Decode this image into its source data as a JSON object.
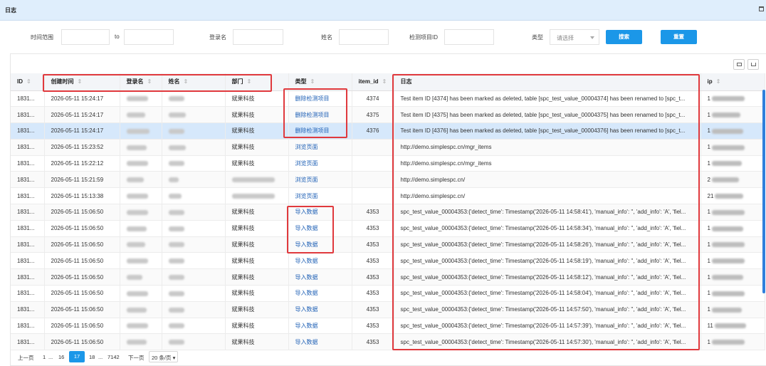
{
  "window": {
    "title": "日志"
  },
  "filters": {
    "time_range_label": "时间范围",
    "to_label": "to",
    "login_label": "登录名",
    "name_label": "姓名",
    "item_id_label": "检测项目ID",
    "type_label": "类型",
    "type_placeholder": "请选择",
    "search_button": "搜索",
    "reset_button": "重置"
  },
  "table": {
    "columns": [
      "ID",
      "创建时间",
      "登录名",
      "姓名",
      "部门",
      "类型",
      "item_id",
      "日志",
      "ip"
    ],
    "rows": [
      {
        "id": "1831...",
        "time": "2026-05-11 15:24:17",
        "dept": "斌果科技",
        "type": "删除检测项目",
        "item": "4374",
        "log": "Test item ID [4374] has been marked as deleted, table [spc_test_value_00004374] has been renamed to [spc_t...",
        "ip": "1"
      },
      {
        "id": "1831...",
        "time": "2026-05-11 15:24:17",
        "dept": "斌果科技",
        "type": "删除检测项目",
        "item": "4375",
        "log": "Test item ID [4375] has been marked as deleted, table [spc_test_value_00004375] has been renamed to [spc_t...",
        "ip": "1"
      },
      {
        "id": "1831...",
        "time": "2026-05-11 15:24:17",
        "dept": "斌果科技",
        "type": "删除检测项目",
        "item": "4376",
        "log": "Test item ID [4376] has been marked as deleted, table [spc_test_value_00004376] has been renamed to [spc_t...",
        "ip": "1"
      },
      {
        "id": "1831...",
        "time": "2026-05-11 15:23:52",
        "dept": "斌果科技",
        "type": "浏览页面",
        "item": "",
        "log": "http://demo.simplespc.cn/mgr_items",
        "ip": "1"
      },
      {
        "id": "1831...",
        "time": "2026-05-11 15:22:12",
        "dept": "斌果科技",
        "type": "浏览页面",
        "item": "",
        "log": "http://demo.simplespc.cn/mgr_items",
        "ip": "1"
      },
      {
        "id": "1831...",
        "time": "2026-05-11 15:21:59",
        "dept": "",
        "type": "浏览页面",
        "item": "",
        "log": "http://demo.simplespc.cn/",
        "ip": "2"
      },
      {
        "id": "1831...",
        "time": "2026-05-11 15:13:38",
        "dept": "",
        "type": "浏览页面",
        "item": "",
        "log": "http://demo.simplespc.cn/",
        "ip": "21"
      },
      {
        "id": "1831...",
        "time": "2026-05-11 15:06:50",
        "dept": "斌果科技",
        "type": "导入数据",
        "item": "4353",
        "log": "spc_test_value_00004353:{'detect_time': Timestamp('2026-05-11 14:58:41'), 'manual_info': '', 'add_info': 'A', 'fiel...",
        "ip": "1"
      },
      {
        "id": "1831...",
        "time": "2026-05-11 15:06:50",
        "dept": "斌果科技",
        "type": "导入数据",
        "item": "4353",
        "log": "spc_test_value_00004353:{'detect_time': Timestamp('2026-05-11 14:58:34'), 'manual_info': '', 'add_info': 'A', 'fiel...",
        "ip": "1"
      },
      {
        "id": "1831...",
        "time": "2026-05-11 15:06:50",
        "dept": "斌果科技",
        "type": "导入数据",
        "item": "4353",
        "log": "spc_test_value_00004353:{'detect_time': Timestamp('2026-05-11 14:58:26'), 'manual_info': '', 'add_info': 'A', 'fiel...",
        "ip": "1"
      },
      {
        "id": "1831...",
        "time": "2026-05-11 15:06:50",
        "dept": "斌果科技",
        "type": "导入数据",
        "item": "4353",
        "log": "spc_test_value_00004353:{'detect_time': Timestamp('2026-05-11 14:58:19'), 'manual_info': '', 'add_info': 'A', 'fiel...",
        "ip": "1"
      },
      {
        "id": "1831...",
        "time": "2026-05-11 15:06:50",
        "dept": "斌果科技",
        "type": "导入数据",
        "item": "4353",
        "log": "spc_test_value_00004353:{'detect_time': Timestamp('2026-05-11 14:58:12'), 'manual_info': '', 'add_info': 'A', 'fiel...",
        "ip": "1"
      },
      {
        "id": "1831...",
        "time": "2026-05-11 15:06:50",
        "dept": "斌果科技",
        "type": "导入数据",
        "item": "4353",
        "log": "spc_test_value_00004353:{'detect_time': Timestamp('2026-05-11 14:58:04'), 'manual_info': '', 'add_info': 'A', 'fiel...",
        "ip": "1"
      },
      {
        "id": "1831...",
        "time": "2026-05-11 15:06:50",
        "dept": "斌果科技",
        "type": "导入数据",
        "item": "4353",
        "log": "spc_test_value_00004353:{'detect_time': Timestamp('2026-05-11 14:57:50'), 'manual_info': '', 'add_info': 'A', 'fiel...",
        "ip": "1"
      },
      {
        "id": "1831...",
        "time": "2026-05-11 15:06:50",
        "dept": "斌果科技",
        "type": "导入数据",
        "item": "4353",
        "log": "spc_test_value_00004353:{'detect_time': Timestamp('2026-05-11 14:57:39'), 'manual_info': '', 'add_info': 'A', 'fiel...",
        "ip": "11"
      },
      {
        "id": "1831...",
        "time": "2026-05-11 15:06:50",
        "dept": "斌果科技",
        "type": "导入数据",
        "item": "4353",
        "log": "spc_test_value_00004353:{'detect_time': Timestamp('2026-05-11 14:57:30'), 'manual_info': '', 'add_info': 'A', 'fiel...",
        "ip": "1"
      }
    ],
    "selected_row": 2
  },
  "pager": {
    "prev": "上一页",
    "first": "1",
    "ellipsis1": "...",
    "p16": "16",
    "current": "17",
    "p18": "18",
    "ellipsis2": "...",
    "last": "7142",
    "next": "下一页",
    "page_size": "20 条/页"
  },
  "colors": {
    "accent": "#1b97e8",
    "highlight_box": "#e0393d",
    "selected_row": "#d6e8fb"
  }
}
